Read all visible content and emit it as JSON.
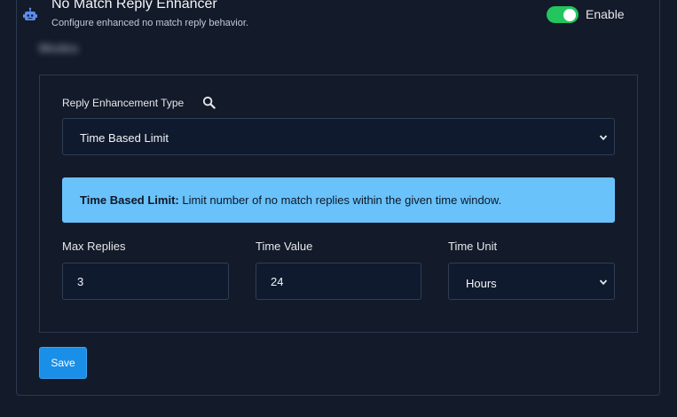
{
  "header": {
    "title": "No Match Reply Enhancer",
    "subtitle": "Configure enhanced no match reply behavior.",
    "toggle_label": "Enable",
    "toggle_on": true,
    "icon": "robot-icon"
  },
  "section": {
    "heading": "Modes"
  },
  "reply_type": {
    "label": "Reply Enhancement Type",
    "selected": "Time Based Limit",
    "search_icon": "search-icon"
  },
  "info": {
    "title": "Time Based Limit:",
    "text": "Limit number of no match replies within the given time window."
  },
  "fields": {
    "max_replies_label": "Max Replies",
    "max_replies_value": "3",
    "time_value_label": "Time Value",
    "time_value_value": "24",
    "time_unit_label": "Time Unit",
    "time_unit_selected": "Hours"
  },
  "actions": {
    "save_label": "Save"
  },
  "colors": {
    "background": "#131a29",
    "toggle_on": "#22c55e",
    "info_bg": "#6ac2fb",
    "primary_button": "#1a8fe8",
    "icon_blue": "#5b8def"
  }
}
